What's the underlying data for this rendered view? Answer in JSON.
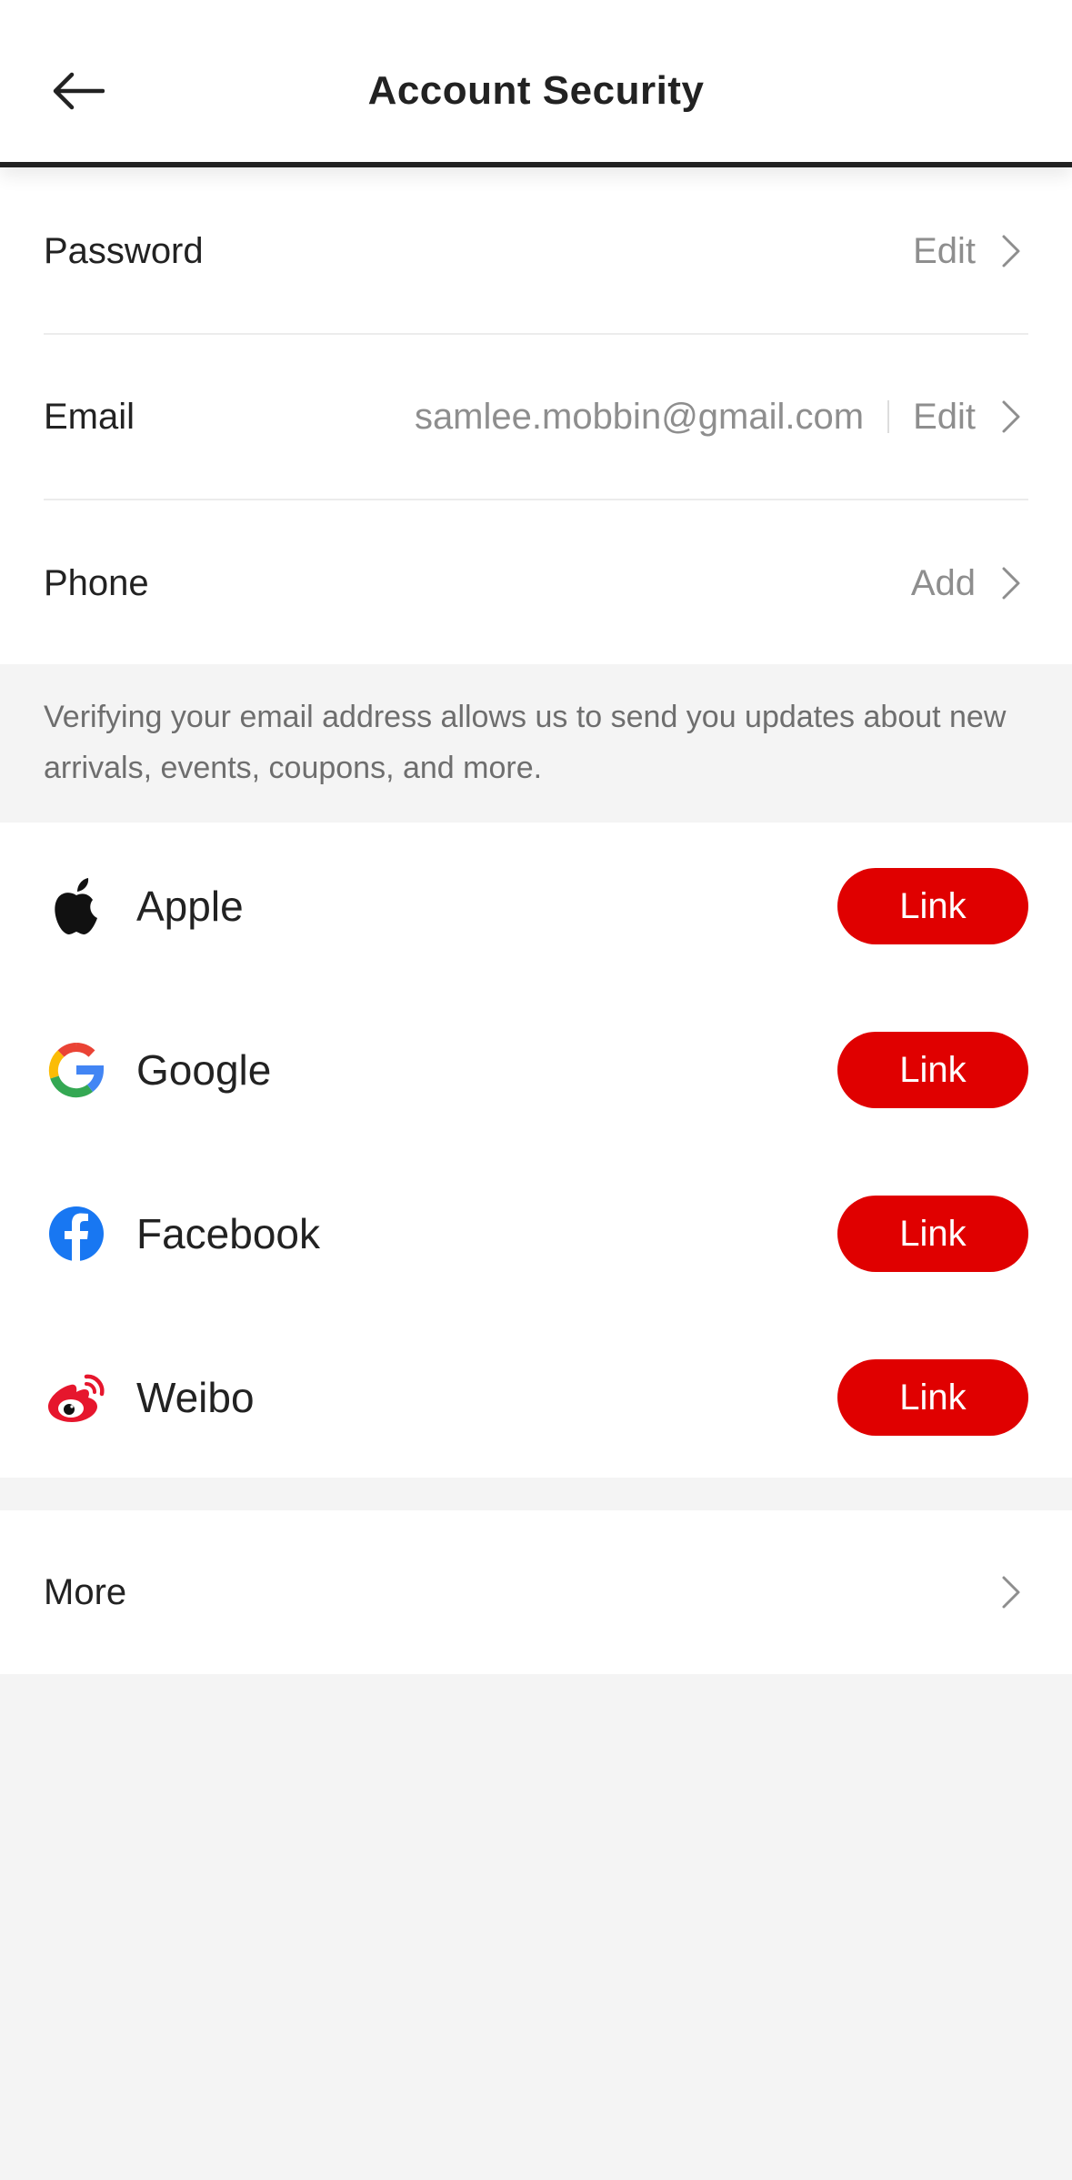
{
  "header": {
    "title": "Account Security"
  },
  "security_rows": [
    {
      "label": "Password",
      "value": "",
      "action": "Edit"
    },
    {
      "label": "Email",
      "value": "samlee.mobbin@gmail.com",
      "action": "Edit"
    },
    {
      "label": "Phone",
      "value": "",
      "action": "Add"
    }
  ],
  "info": {
    "text": "Verifying your email address allows us to send you updates about new arrivals, events, coupons, and more."
  },
  "social": [
    {
      "name": "Apple",
      "icon": "apple-icon",
      "action": "Link"
    },
    {
      "name": "Google",
      "icon": "google-icon",
      "action": "Link"
    },
    {
      "name": "Facebook",
      "icon": "facebook-icon",
      "action": "Link"
    },
    {
      "name": "Weibo",
      "icon": "weibo-icon",
      "action": "Link"
    }
  ],
  "more": {
    "label": "More"
  },
  "colors": {
    "accent": "#e00000",
    "text": "#222222",
    "muted": "#8e8e8e",
    "background": "#f4f4f4"
  }
}
